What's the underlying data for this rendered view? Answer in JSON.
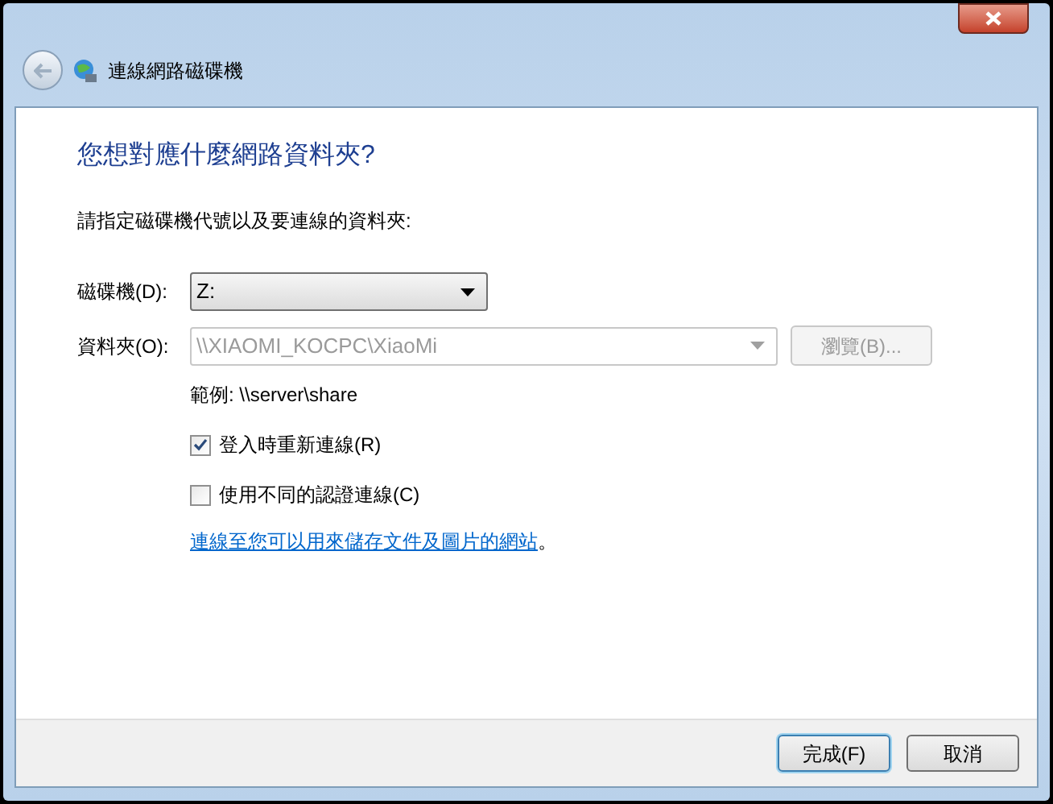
{
  "window": {
    "title": "連線網路磁碟機"
  },
  "heading": "您想對應什麼網路資料夾?",
  "instruction": "請指定磁碟機代號以及要連線的資料夾:",
  "drive": {
    "label": "磁碟機(D):",
    "value": "Z:",
    "disabled": false
  },
  "folder": {
    "label": "資料夾(O):",
    "value": "\\\\XIAOMI_KOCPC\\XiaoMi",
    "disabled": true
  },
  "browse_button": {
    "label": "瀏覽(B)...",
    "disabled": true
  },
  "example": "範例: \\\\server\\share",
  "options": [
    {
      "label": "登入時重新連線(R)",
      "checked": true
    },
    {
      "label": "使用不同的認證連線(C)",
      "checked": false
    }
  ],
  "link": "連線至您可以用來儲存文件及圖片的網站",
  "link_suffix": "。",
  "buttons": [
    {
      "label": "完成(F)",
      "selected": true
    },
    {
      "label": "取消",
      "selected": false
    }
  ]
}
